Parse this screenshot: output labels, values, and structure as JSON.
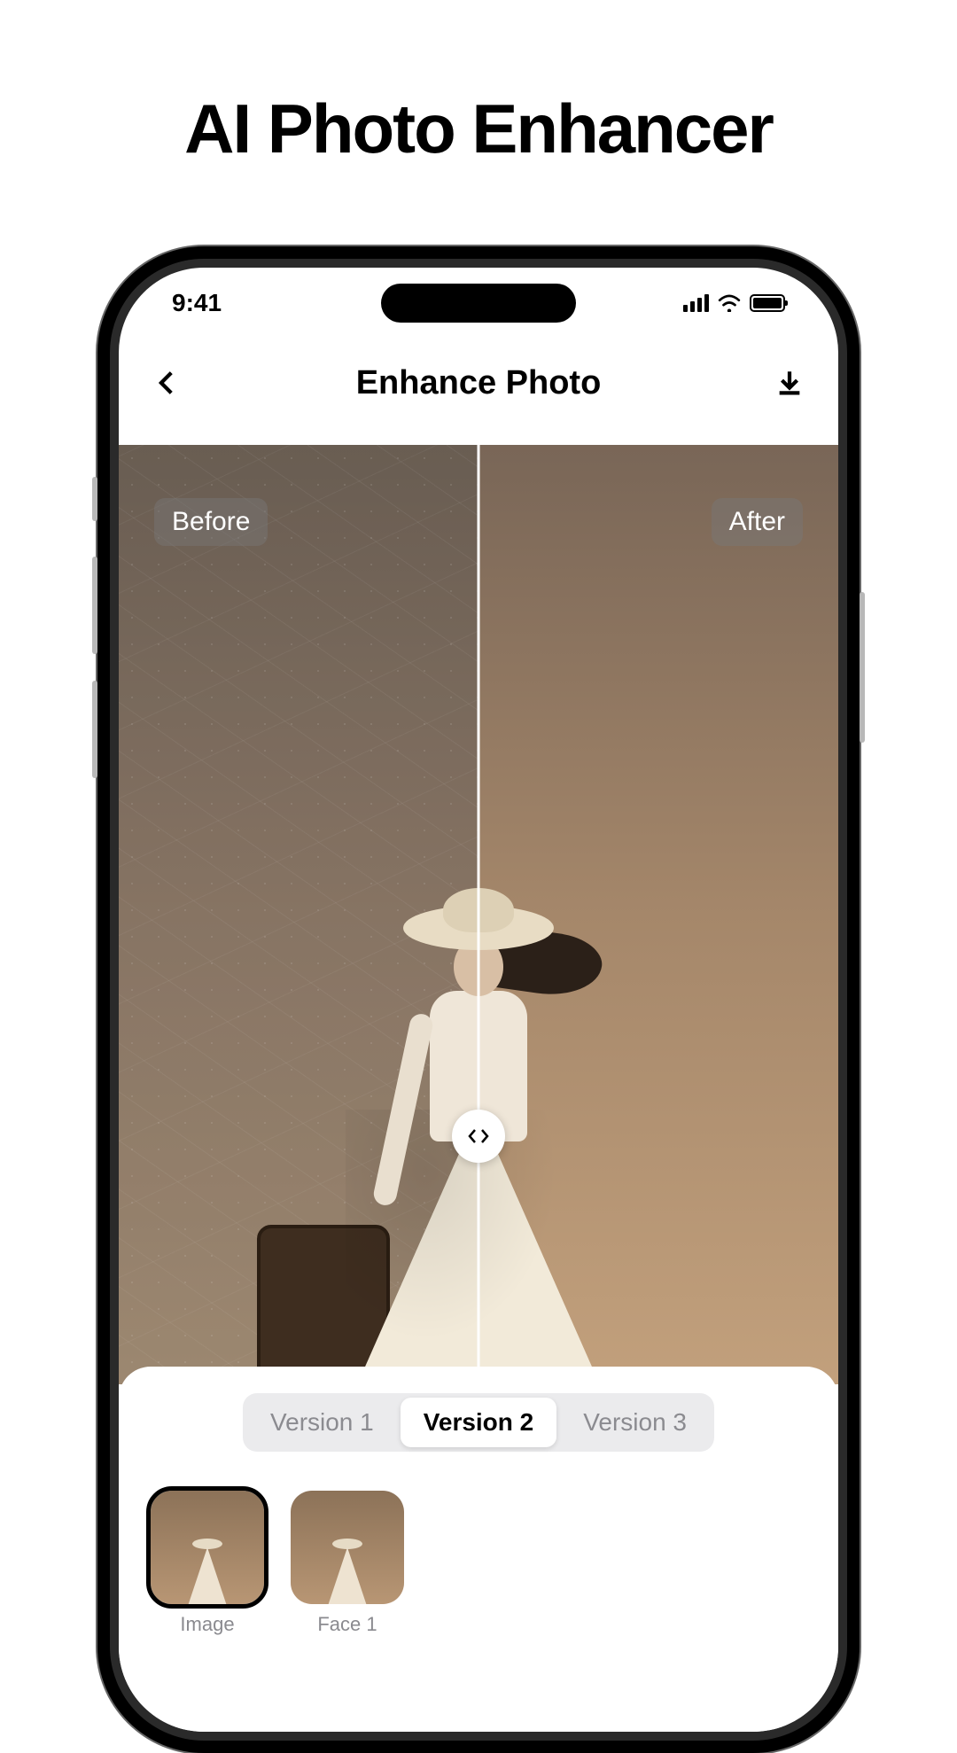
{
  "promo": {
    "title": "AI Photo Enhancer"
  },
  "status": {
    "time": "9:41"
  },
  "nav": {
    "title": "Enhance Photo"
  },
  "compare": {
    "before_label": "Before",
    "after_label": "After"
  },
  "versions": {
    "tabs": [
      {
        "label": "Version 1"
      },
      {
        "label": "Version 2"
      },
      {
        "label": "Version 3"
      }
    ],
    "selected_index": 1
  },
  "thumbs": [
    {
      "label": "Image",
      "selected": true
    },
    {
      "label": "Face 1",
      "selected": false
    }
  ]
}
